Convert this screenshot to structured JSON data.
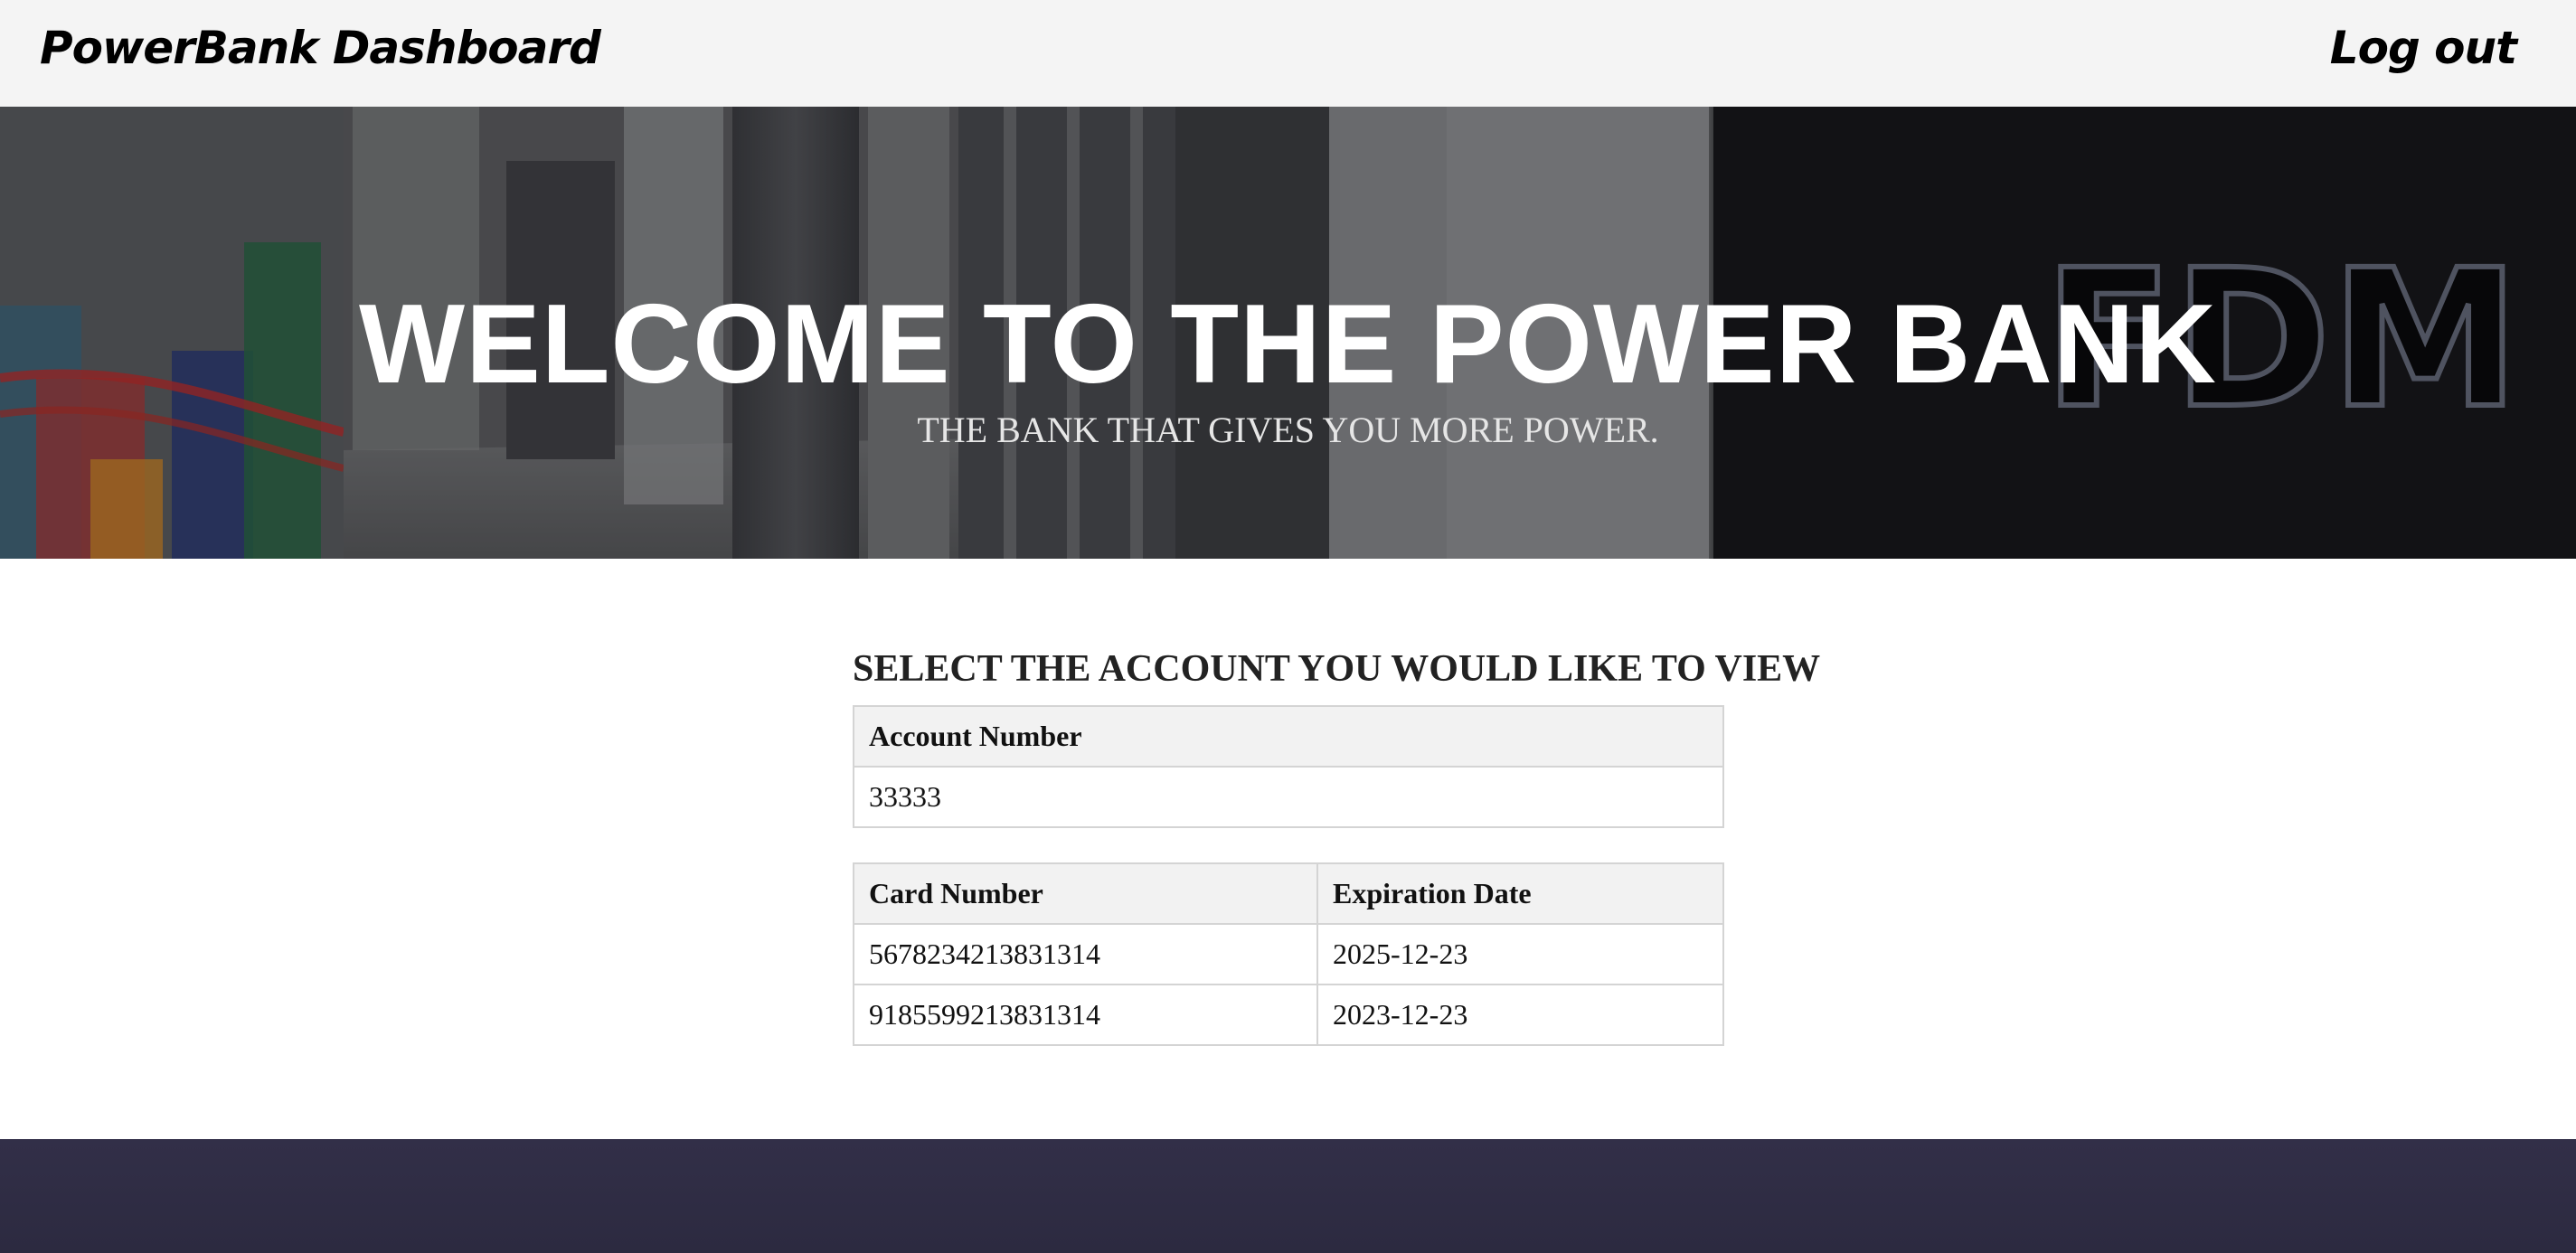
{
  "nav": {
    "brand": "PowerBank Dashboard",
    "logout": "Log out"
  },
  "hero": {
    "title": "WELCOME TO THE POWER BANK",
    "subtitle": "THE BANK THAT GIVES YOU MORE POWER.",
    "sign_text": "FDM"
  },
  "main": {
    "heading": "SELECT THE ACCOUNT YOU WOULD LIKE TO VIEW",
    "accounts_table": {
      "headers": [
        "Account Number"
      ],
      "rows": [
        [
          "33333"
        ]
      ]
    },
    "cards_table": {
      "headers": [
        "Card Number",
        "Expiration Date"
      ],
      "rows": [
        [
          "5678234213831314",
          "2025-12-23"
        ],
        [
          "9185599213831314",
          "2023-12-23"
        ]
      ]
    }
  },
  "colors": {
    "topbar_bg": "#f4f4f4",
    "footer_bg": "#322f48",
    "table_header_bg": "#f2f2f2",
    "table_border": "#d4d4d4"
  }
}
